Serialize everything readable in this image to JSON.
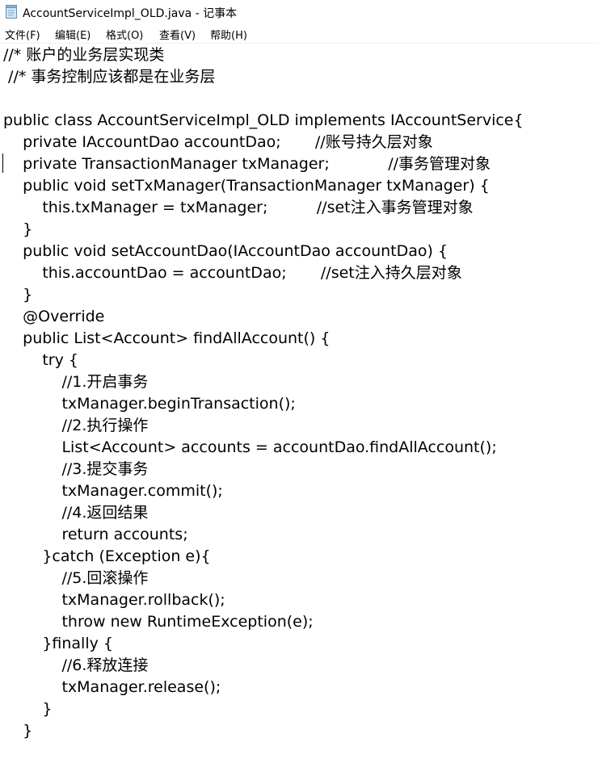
{
  "window": {
    "title": "AccountServiceImpl_OLD.java - 记事本",
    "icon": "notepad-icon"
  },
  "menu": {
    "items": [
      {
        "label": "文件(F)"
      },
      {
        "label": "编辑(E)"
      },
      {
        "label": "格式(O)"
      },
      {
        "label": "查看(V)"
      },
      {
        "label": "帮助(H)"
      }
    ]
  },
  "editor": {
    "lines": [
      "//* 账户的业务层实现类",
      " //* 事务控制应该都是在业务层",
      "",
      "public class AccountServiceImpl_OLD implements IAccountService{",
      "    private IAccountDao accountDao;       //账号持久层对象",
      "    private TransactionManager txManager;            //事务管理对象",
      "    public void setTxManager(TransactionManager txManager) {",
      "        this.txManager = txManager;          //set注入事务管理对象",
      "    }",
      "    public void setAccountDao(IAccountDao accountDao) {",
      "        this.accountDao = accountDao;       //set注入持久层对象",
      "    }",
      "    @Override",
      "    public List<Account> findAllAccount() {",
      "        try {",
      "            //1.开启事务",
      "            txManager.beginTransaction();",
      "            //2.执行操作",
      "            List<Account> accounts = accountDao.findAllAccount();",
      "            //3.提交事务",
      "            txManager.commit();",
      "            //4.返回结果",
      "            return accounts;",
      "        }catch (Exception e){",
      "            //5.回滚操作",
      "            txManager.rollback();",
      "            throw new RuntimeException(e);",
      "        }finally {",
      "            //6.释放连接",
      "            txManager.release();",
      "        }",
      "    }"
    ]
  }
}
